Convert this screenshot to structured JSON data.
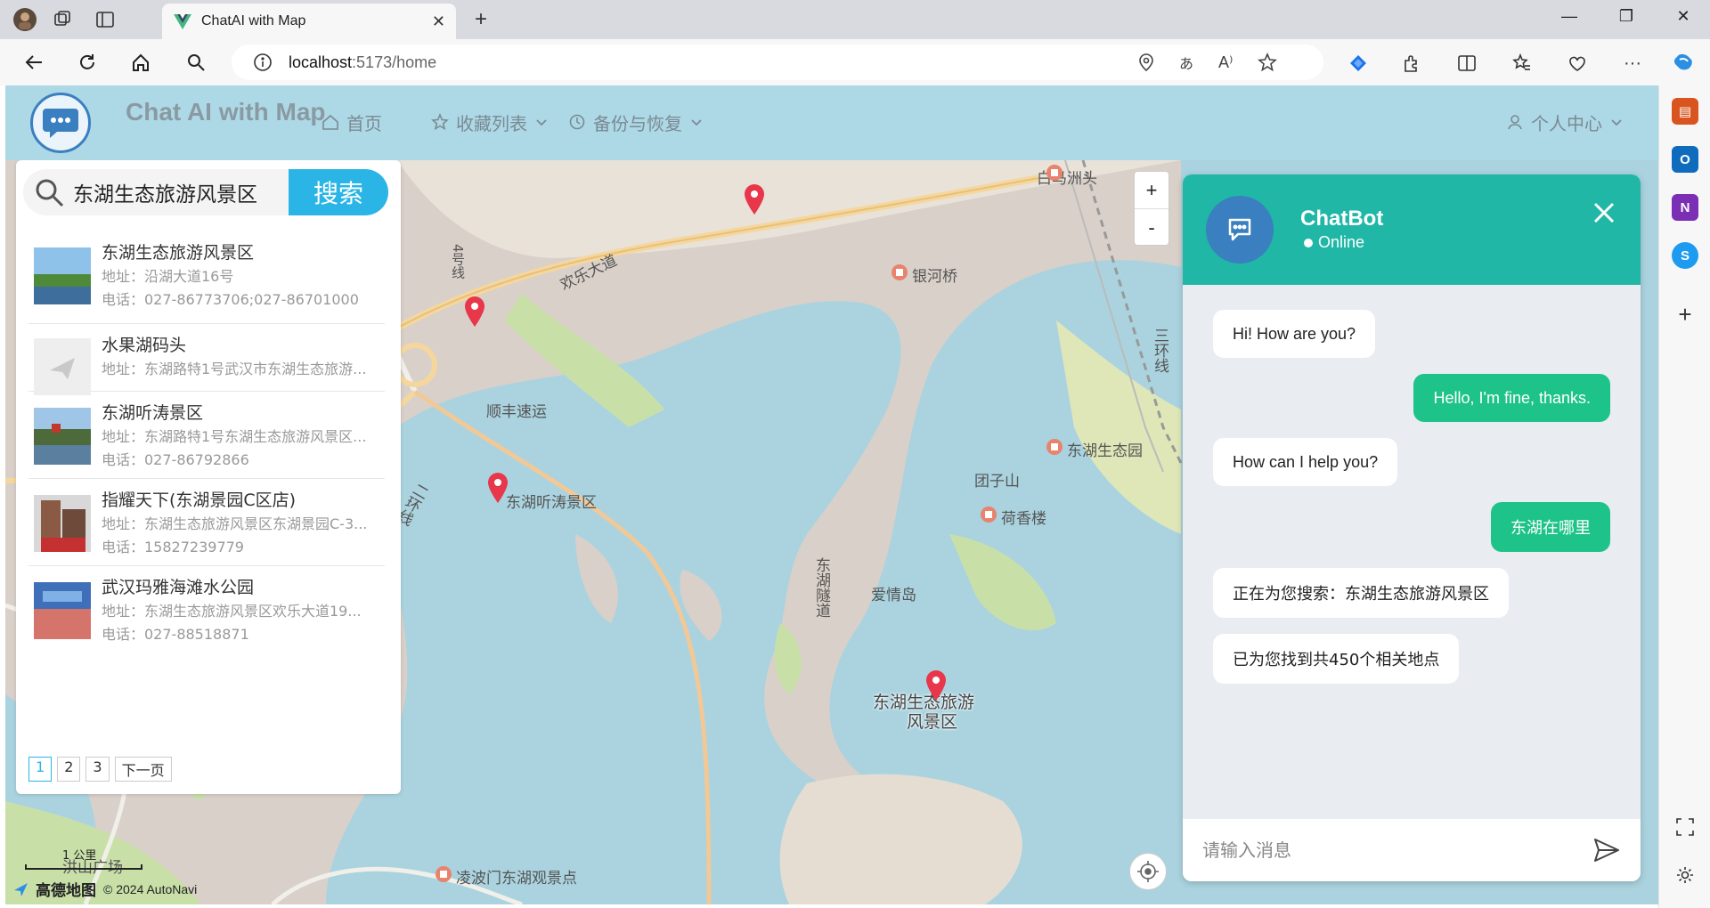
{
  "browser": {
    "tab_title": "ChatAI with Map",
    "url_host": "localhost",
    "url_path": ":5173/home"
  },
  "app": {
    "title": "Chat AI with Map",
    "menu": {
      "home": "首页",
      "favorites": "收藏列表",
      "backup": "备份与恢复",
      "profile": "个人中心"
    }
  },
  "search": {
    "query": "东湖生态旅游风景区",
    "button": "搜索",
    "results": [
      {
        "name": "东湖生态旅游风景区",
        "address": "地址：沿湖大道16号",
        "phone": "电话：027-86773706;027-86701000"
      },
      {
        "name": "水果湖码头",
        "address": "地址：东湖路特1号武汉市东湖生态旅游...",
        "phone": ""
      },
      {
        "name": "东湖听涛景区",
        "address": "地址：东湖路特1号东湖生态旅游风景区...",
        "phone": "电话：027-86792866"
      },
      {
        "name": "指耀天下(东湖景园C区店)",
        "address": "地址：东湖生态旅游风景区东湖景园C-3...",
        "phone": "电话：15827239779"
      },
      {
        "name": "武汉玛雅海滩水公园",
        "address": "地址：东湖生态旅游风景区欢乐大道19...",
        "phone": "电话：027-88518871"
      }
    ],
    "pages": [
      "1",
      "2",
      "3"
    ],
    "next_page": "下一页"
  },
  "map": {
    "labels": {
      "baimazhou": "白马洲头",
      "yinheqiao": "银河桥",
      "huanle": "欢乐大道",
      "line4": "4号线",
      "shunfeng": "顺丰速运",
      "tingtao": "东湖听涛景区",
      "tuanzishan": "团子山",
      "hexianglou": "荷香楼",
      "shengtaiyuan": "东湖生态园",
      "aiqingdao": "爱情岛",
      "tunnel": "东湖隧道",
      "huan3": "三环线",
      "huan2": "二环线",
      "scenic1": "东湖生态旅游",
      "scenic2": "风景区",
      "bottom": "凌波门东湖观景点",
      "hongshan": "洪山广场"
    },
    "zoom_in": "+",
    "zoom_out": "-",
    "scale": "1 公里",
    "provider": "高德地图",
    "copyright": "© 2024 AutoNavi"
  },
  "chat": {
    "bot_name": "ChatBot",
    "status": "Online",
    "messages": [
      {
        "from": "bot",
        "text": "Hi! How are you?"
      },
      {
        "from": "me",
        "text": "Hello, I'm fine, thanks."
      },
      {
        "from": "bot",
        "text": "How can I help you?"
      },
      {
        "from": "me",
        "text": "东湖在哪里"
      },
      {
        "from": "bot",
        "text": "正在为您搜索：东湖生态旅游风景区"
      },
      {
        "from": "bot",
        "text": "已为您找到共450个相关地点"
      }
    ],
    "input_placeholder": "请输入消息"
  }
}
